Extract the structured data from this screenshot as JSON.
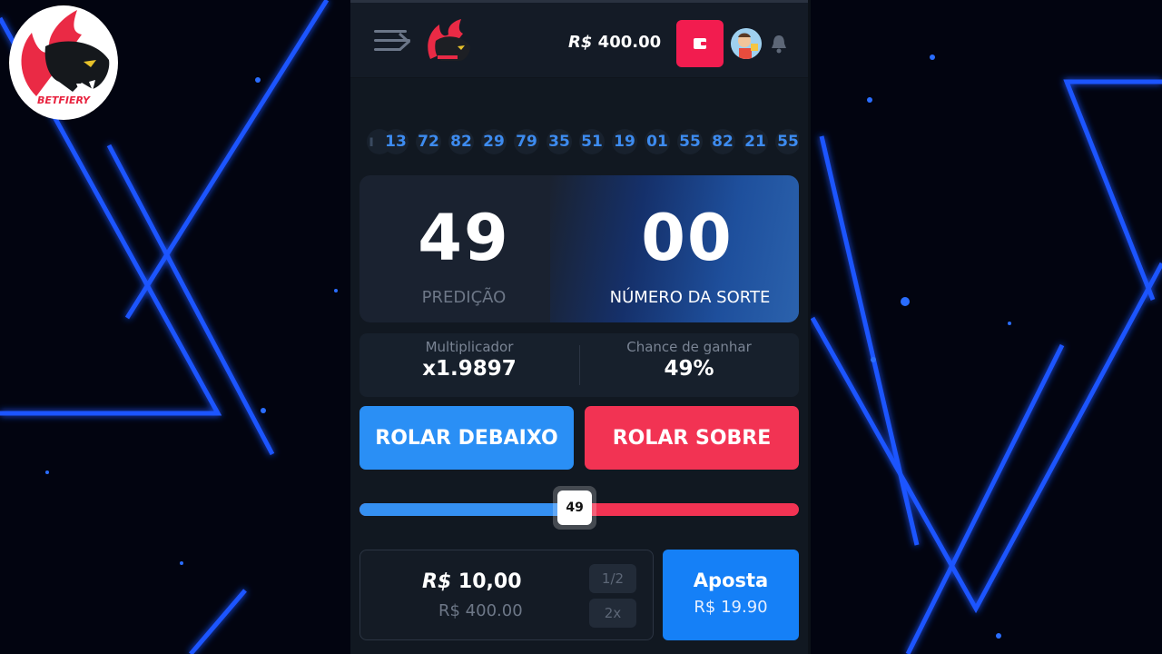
{
  "brand": {
    "name": "BETFIERY",
    "colors": {
      "accent_red": "#f21c4f",
      "accent_blue": "#1580f7"
    }
  },
  "header": {
    "menu_icon": "menu-arrow-icon",
    "balance_currency": "R$",
    "balance_value": "400.00",
    "wallet_icon": "wallet-icon",
    "bell_icon": "bell-icon"
  },
  "history": [
    "13",
    "72",
    "82",
    "29",
    "79",
    "35",
    "51",
    "19",
    "01",
    "55",
    "82",
    "21",
    "55"
  ],
  "prediction": {
    "value": "49",
    "label": "PREDIÇÃO",
    "lucky_value": "00",
    "lucky_label": "NÚMERO DA SORTE"
  },
  "stats": {
    "multiplier_label": "Multiplicador",
    "multiplier_value": "x1.9897",
    "chance_label": "Chance de ganhar",
    "chance_value": "49%"
  },
  "buttons": {
    "roll_under": "ROLAR DEBAIXO",
    "roll_over": "ROLAR SOBRE"
  },
  "slider": {
    "value": 49,
    "min": 0,
    "max": 100,
    "label": "49"
  },
  "bet": {
    "currency": "R$",
    "amount": "10,00",
    "balance": "R$ 400.00",
    "half_label": "1/2",
    "double_label": "2x",
    "submit_label": "Aposta",
    "payout": "R$ 19.90"
  }
}
